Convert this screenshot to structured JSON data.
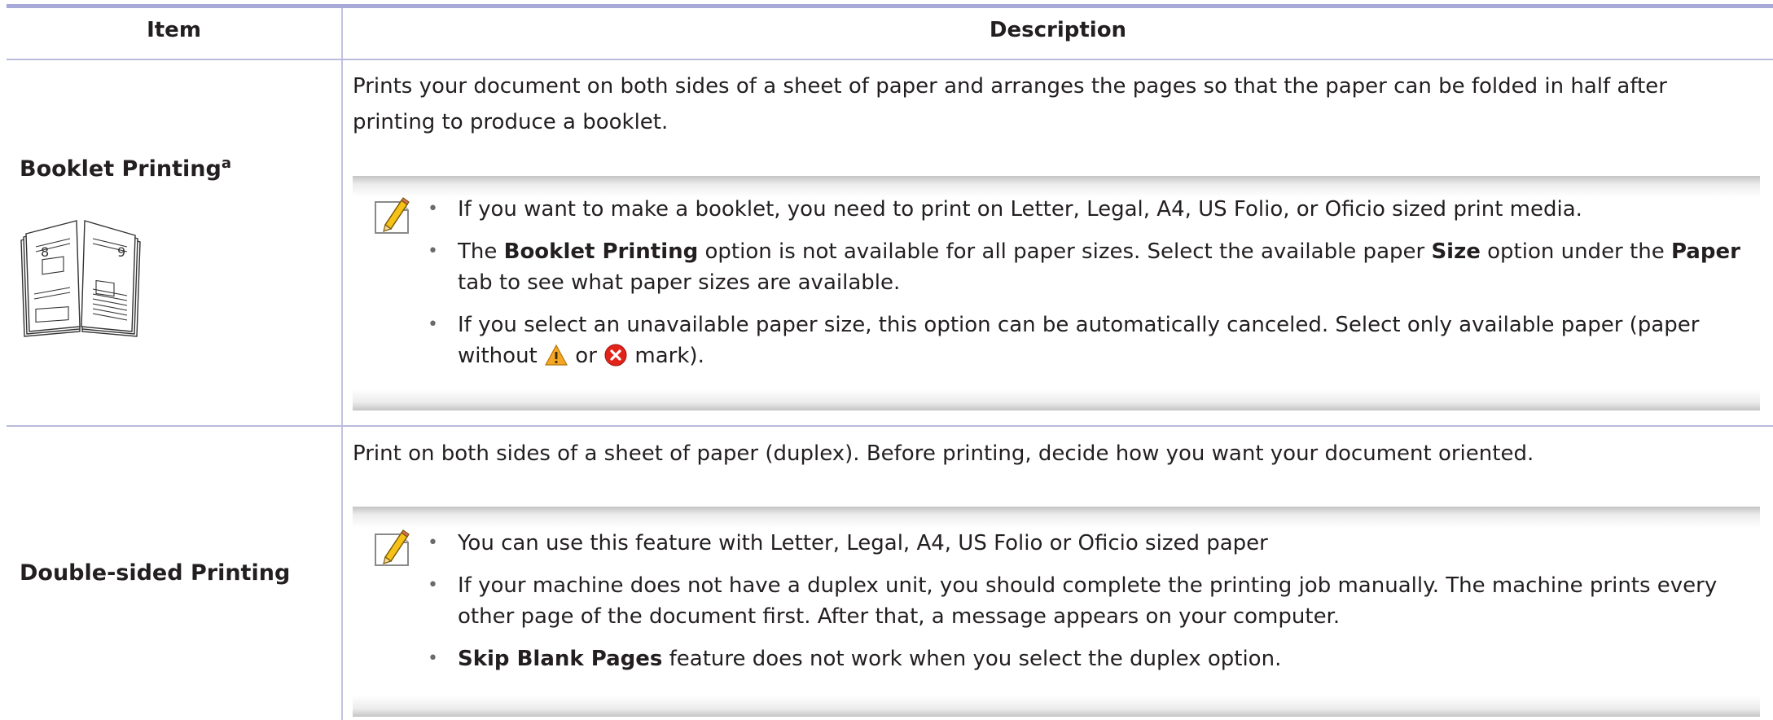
{
  "table": {
    "header": {
      "item": "Item",
      "description": "Description"
    },
    "rows": [
      {
        "item": "Booklet Printing",
        "item_sup": "a",
        "description": "Prints your document on both sides of a sheet of paper and arranges the pages so that the paper can be folded in half after printing to produce a booklet.",
        "note_icon": "note-pencil-icon",
        "image_icon": "booklet-illustration-icon",
        "bullets": [
          {
            "parts": [
              "If you want to make a booklet, you need to print on Letter, Legal, A4, US Folio, or Oficio sized print media."
            ]
          },
          {
            "parts": [
              "The ",
              "Booklet Printing",
              " option is not available for all paper sizes. Select the available paper ",
              "Size",
              " option under the ",
              "Paper",
              " tab to see what paper sizes are available."
            ]
          },
          {
            "parts": [
              "If you select an unavailable paper size, this option can be automatically canceled. Select only available paper (paper without ",
              " or ",
              " mark)."
            ],
            "icons": [
              "warning-triangle-icon",
              "red-x-circle-icon"
            ]
          }
        ]
      },
      {
        "item": "Double-sided Printing",
        "description": "Print on both sides of a sheet of paper (duplex). Before printing, decide how you want your document oriented.",
        "note_icon": "note-pencil-icon",
        "bullets": [
          {
            "parts": [
              "You can use this feature with Letter, Legal, A4, US Folio or Oficio sized paper"
            ]
          },
          {
            "parts": [
              "If your machine does not have a duplex unit, you should complete the printing job manually. The machine prints every other page of the document first. After that, a message appears on your computer."
            ]
          },
          {
            "parts": [
              "Skip Blank Pages",
              " feature does not work when you select the duplex option."
            ]
          }
        ]
      }
    ]
  },
  "colors": {
    "rule": "#a7a9d6",
    "text": "#231f20",
    "note_shade": "#c4c4c4",
    "warning": "#f5a623",
    "error": "#e2231a"
  }
}
